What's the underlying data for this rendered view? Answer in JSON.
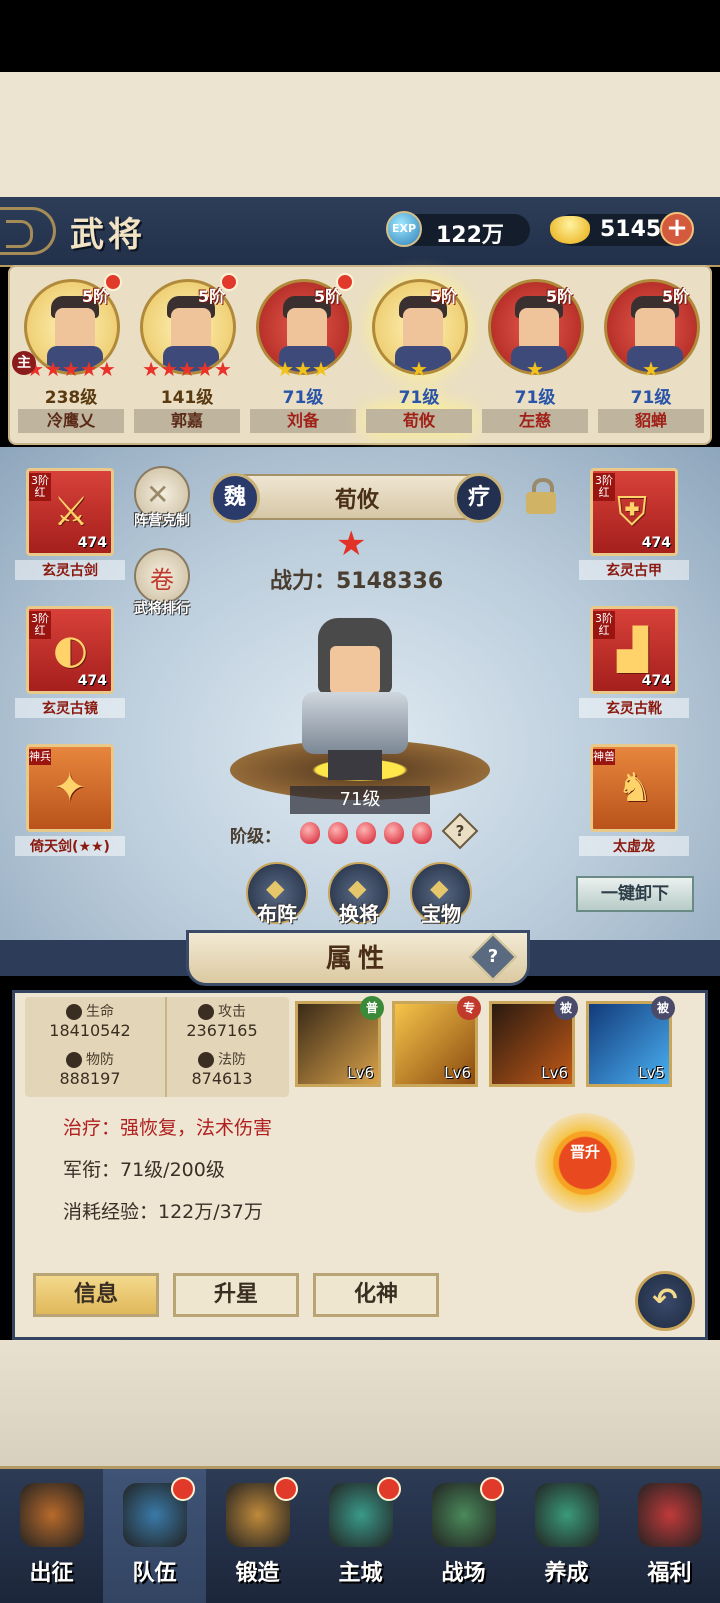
{
  "header": {
    "title": "武将",
    "exp_value": "122万",
    "exp_icon": "EXP",
    "gold_value": "5145",
    "plus": "+"
  },
  "heroes": [
    {
      "rank": "5阶",
      "level": "238级",
      "name": "冷鹰乂",
      "stars": "★★★★★",
      "frame": "gold",
      "main_badge": "主",
      "has_dot": true
    },
    {
      "rank": "5阶",
      "level": "141级",
      "name": "郭嘉",
      "stars": "★★★★★",
      "frame": "gold",
      "has_dot": true
    },
    {
      "rank": "5阶",
      "level": "71级",
      "name": "刘备",
      "stars": "★★★",
      "frame": "red",
      "has_dot": true
    },
    {
      "rank": "5阶",
      "level": "71级",
      "name": "荀攸",
      "stars": "★",
      "frame": "gold",
      "selected": true
    },
    {
      "rank": "5阶",
      "level": "71级",
      "name": "左慈",
      "stars": "★",
      "frame": "red"
    },
    {
      "rank": "5阶",
      "level": "71级",
      "name": "貂蝉",
      "stars": "★",
      "frame": "red"
    }
  ],
  "equipment_left": [
    {
      "tag": "3阶红",
      "count": "474",
      "label": "玄灵古剑"
    },
    {
      "tag": "3阶红",
      "count": "474",
      "label": "玄灵古镜"
    },
    {
      "tag": "神兵",
      "label": "倚天剑(★★)"
    }
  ],
  "equipment_right": [
    {
      "tag": "3阶红",
      "count": "474",
      "label": "玄灵古甲"
    },
    {
      "tag": "3阶红",
      "count": "474",
      "label": "玄灵古靴"
    },
    {
      "tag": "神兽",
      "label": "太虚龙"
    }
  ],
  "side_buttons": {
    "formation_study": "阵营克制",
    "ranking": "武将排行"
  },
  "hero": {
    "faction": "魏",
    "name": "荀攸",
    "role": "疗",
    "power": "战力：5148336",
    "level": "71级",
    "grade_label": "阶级：",
    "grade_gems": 5,
    "unload_all": "一键卸下"
  },
  "actions": [
    "布阵",
    "换将",
    "宝物"
  ],
  "panel": {
    "title": "属性",
    "help": "?",
    "stats": [
      {
        "label": "生命",
        "value": "18410542"
      },
      {
        "label": "攻击",
        "value": "2367165"
      },
      {
        "label": "物防",
        "value": "888197"
      },
      {
        "label": "法防",
        "value": "874613"
      }
    ],
    "skills": [
      {
        "badge": "普",
        "level": "Lv6",
        "badge_color": "#3a8a3a"
      },
      {
        "badge": "专",
        "level": "Lv6",
        "badge_color": "#c0392b"
      },
      {
        "badge": "被",
        "level": "Lv6",
        "badge_color": "#4a4a6a"
      },
      {
        "badge": "被",
        "level": "Lv5",
        "badge_color": "#4a4a6a"
      }
    ],
    "specialty": "治疗：强恢复，法术伤害",
    "rank": "军衔：71级/200级",
    "exp_cost": "消耗经验：122万/37万",
    "promote": "晋升",
    "tabs": [
      "信息",
      "升星",
      "化神"
    ]
  },
  "nav": [
    {
      "label": "出征",
      "has_dot": false
    },
    {
      "label": "队伍",
      "has_dot": true,
      "active": true
    },
    {
      "label": "锻造",
      "has_dot": true
    },
    {
      "label": "主城",
      "has_dot": true
    },
    {
      "label": "战场",
      "has_dot": true
    },
    {
      "label": "养成",
      "has_dot": false
    },
    {
      "label": "福利",
      "has_dot": false
    }
  ],
  "colors": {
    "accent_gold": "#e0b85a",
    "header_navy": "#2e3e58",
    "alert_red": "#e23a2a"
  }
}
